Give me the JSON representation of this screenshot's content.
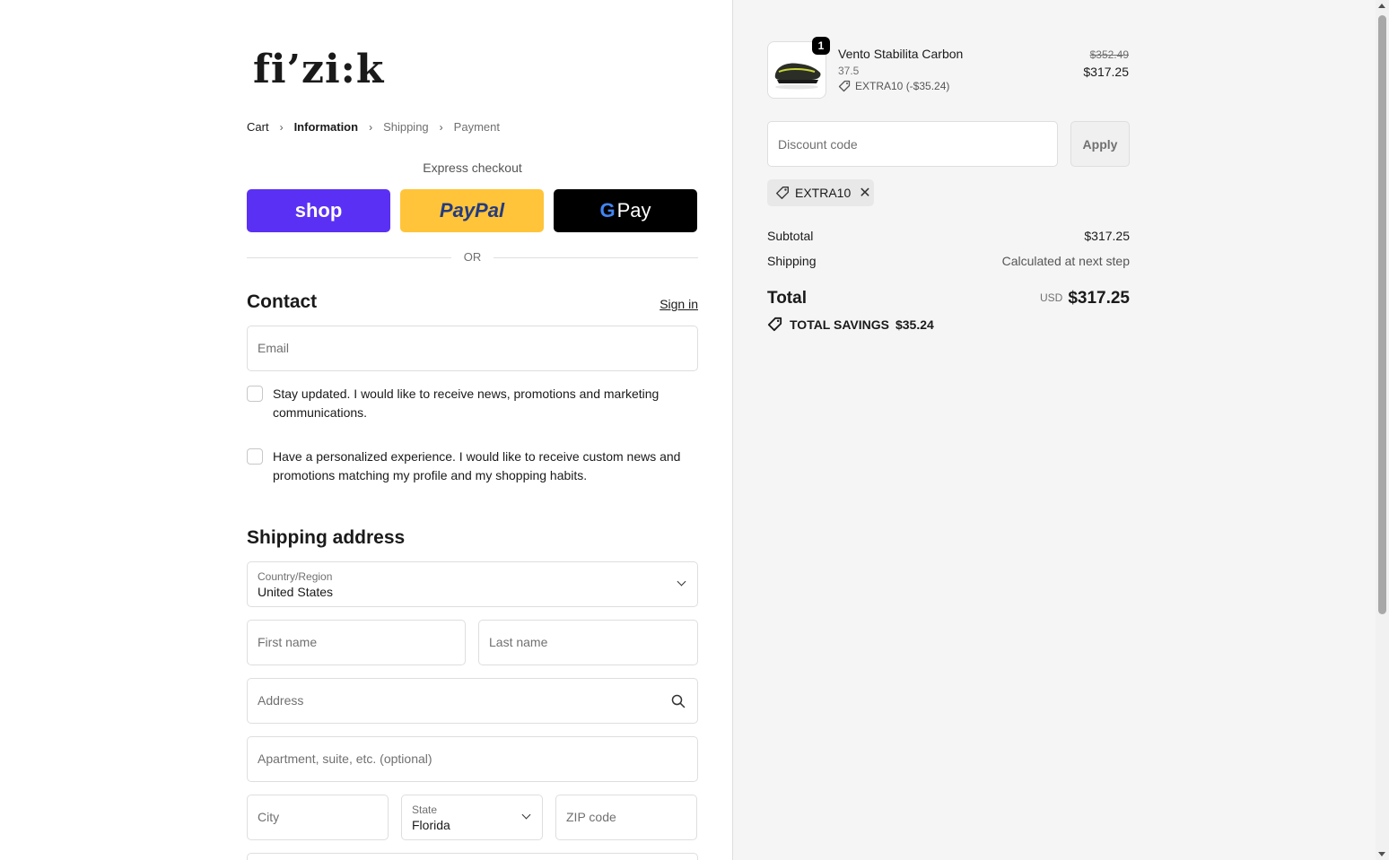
{
  "brand": {
    "logo_text": "fi’zi:k"
  },
  "breadcrumb": [
    {
      "label": "Cart",
      "state": "link"
    },
    {
      "label": "Information",
      "state": "active"
    },
    {
      "label": "Shipping",
      "state": "upcoming"
    },
    {
      "label": "Payment",
      "state": "upcoming"
    }
  ],
  "express": {
    "title": "Express checkout",
    "shop_label": "shop",
    "paypal_label": "PayPal",
    "gpay_g": "G",
    "gpay_label": "Pay",
    "or_label": "OR"
  },
  "contact": {
    "heading": "Contact",
    "signin_label": "Sign in",
    "email_placeholder": "Email",
    "newsletter_text": "Stay updated. I would like to receive news, promotions and marketing communications.",
    "personalized_text": "Have a personalized experience. I would like to receive custom news and promotions matching my profile and my shopping habits."
  },
  "shipping": {
    "heading": "Shipping address",
    "country_label": "Country/Region",
    "country_value": "United States",
    "first_name_placeholder": "First name",
    "last_name_placeholder": "Last name",
    "address_placeholder": "Address",
    "apartment_placeholder": "Apartment, suite, etc. (optional)",
    "city_placeholder": "City",
    "state_label": "State",
    "state_value": "Florida",
    "zip_placeholder": "ZIP code"
  },
  "order": {
    "item": {
      "name": "Vento Stabilita Carbon",
      "variant": "37.5",
      "quantity": "1",
      "discount_line": "EXTRA10 (-$35.24)",
      "original_price": "$352.49",
      "price": "$317.25"
    },
    "discount_placeholder": "Discount code",
    "apply_label": "Apply",
    "applied_code": "EXTRA10",
    "subtotal_label": "Subtotal",
    "subtotal_value": "$317.25",
    "shipping_label": "Shipping",
    "shipping_value": "Calculated at next step",
    "total_label": "Total",
    "currency": "USD",
    "total_value": "$317.25",
    "savings_label": "TOTAL SAVINGS",
    "savings_value": "$35.24"
  },
  "colors": {
    "shop_purple": "#5a31f4",
    "paypal_yellow": "#ffc439",
    "gpay_black": "#000000",
    "summary_bg": "#f5f5f5"
  }
}
